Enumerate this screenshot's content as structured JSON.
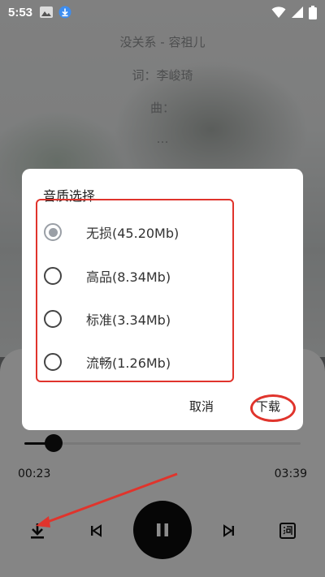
{
  "status_bar": {
    "time": "5:53"
  },
  "lyrics": {
    "line1": "没关系 - 容祖儿",
    "line2": "词：李峻琦",
    "line3": "曲：",
    "line4": "…",
    "line5": "…"
  },
  "player": {
    "elapsed": "00:23",
    "duration": "03:39",
    "progress_fraction": 0.107
  },
  "dialog": {
    "title": "音质选择",
    "options": [
      {
        "label": "无损(45.20Mb)",
        "checked": true
      },
      {
        "label": "高品(8.34Mb)",
        "checked": false
      },
      {
        "label": "标准(3.34Mb)",
        "checked": false
      },
      {
        "label": "流畅(1.26Mb)",
        "checked": false
      }
    ],
    "cancel_label": "取消",
    "download_label": "下载"
  },
  "colors": {
    "annotation": "#e0342c",
    "scrim": "rgba(0,0,0,0.45)",
    "radio_checked": "#9a9fa6"
  },
  "icons": {
    "download": "download-icon",
    "previous": "skip-previous-icon",
    "pause": "pause-icon",
    "next": "skip-next-icon",
    "lyrics": "lyrics-icon"
  }
}
